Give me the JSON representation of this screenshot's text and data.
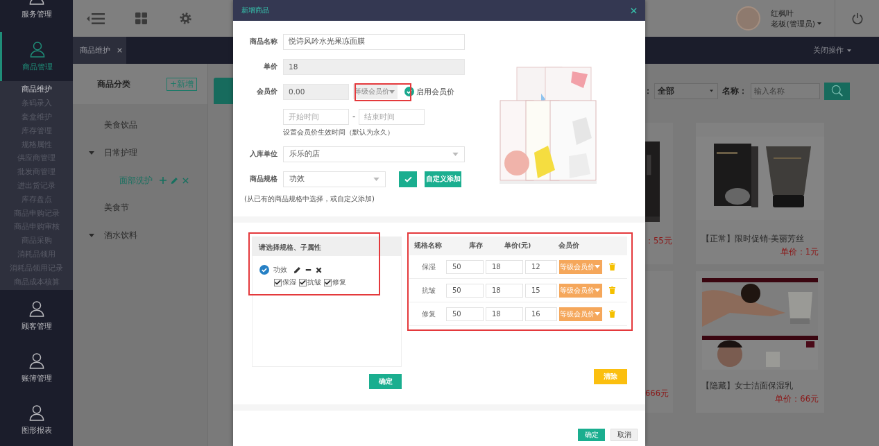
{
  "sidebar": {
    "items": [
      {
        "label": "服务管理",
        "selected": false
      },
      {
        "label": "商品管理",
        "selected": true,
        "children": [
          {
            "label": "商品维护",
            "selected": true
          },
          {
            "label": "条码录入",
            "selected": false
          },
          {
            "label": "套盒维护",
            "selected": false
          },
          {
            "label": "库存管理",
            "selected": false
          },
          {
            "label": "规格属性",
            "selected": false
          },
          {
            "label": "供应商管理",
            "selected": false
          },
          {
            "label": "批发商管理",
            "selected": false
          },
          {
            "label": "进出货记录",
            "selected": false
          },
          {
            "label": "库存盘点",
            "selected": false
          },
          {
            "label": "商品申购记录",
            "selected": false
          },
          {
            "label": "商品申购审核",
            "selected": false
          },
          {
            "label": "商品采购",
            "selected": false
          },
          {
            "label": "消耗品领用",
            "selected": false
          },
          {
            "label": "消耗品领用记录",
            "selected": false
          },
          {
            "label": "商品成本核算",
            "selected": false
          }
        ]
      },
      {
        "label": "顾客管理",
        "selected": false
      },
      {
        "label": "账簿管理",
        "selected": false
      },
      {
        "label": "图形报表",
        "selected": false
      }
    ]
  },
  "header": {
    "user": {
      "name": "红枫叶",
      "role": "老板(管理员)"
    }
  },
  "tabs": [
    {
      "label": "商品维护",
      "selected": true
    }
  ],
  "close_menu": "关闭操作",
  "category_panel": {
    "title": "商品分类",
    "add_button": "+新增",
    "tree": [
      {
        "label": "美食饮品",
        "kind": "leaf",
        "selected": false
      },
      {
        "label": "日常护理",
        "kind": "group",
        "expanded": true,
        "selected": false,
        "children": [
          {
            "label": "面部洗护",
            "selected": true
          }
        ]
      },
      {
        "label": "美食节",
        "kind": "leaf",
        "selected": false
      },
      {
        "label": "酒水饮料",
        "kind": "group",
        "expanded": true,
        "selected": false
      }
    ]
  },
  "filter": {
    "type_label": "：",
    "type_value": "全部",
    "name_label": "名称：",
    "name_placeholder": "输入名称"
  },
  "product_columns": [
    {
      "kind": "partial",
      "cards": [
        {
          "price": "：55元"
        },
        {
          "price": "666元"
        }
      ]
    },
    {
      "kind": "full",
      "cards": [
        {
          "title": "【正常】限时促销-美丽芳丝",
          "price": "单价：1元"
        },
        {
          "title": "【隐藏】女士洁面保湿乳",
          "price": "单价：66元"
        }
      ]
    }
  ],
  "dialog": {
    "title": "新增商品",
    "name": {
      "label": "商品名称",
      "value": "悦诗风吟水光果冻面膜"
    },
    "price": {
      "label": "单价",
      "value": "18",
      "disabled": true
    },
    "member_price": {
      "label": "会员价",
      "value": "0.00",
      "disabled": true,
      "level_select": "等级会员价",
      "enable": {
        "label": "启用会员价",
        "checked": true
      }
    },
    "period": {
      "start_placeholder": "开始时间",
      "separator": "-",
      "end_placeholder": "结束时间",
      "hint": "设置会员价生效时间（默认为永久）"
    },
    "store": {
      "label": "入库单位",
      "value": "乐乐的店"
    },
    "spec": {
      "label": "商品规格",
      "value": "功效",
      "custom_button": "自定义添加",
      "hint": "(从已有的商品规格中选择，或自定义添加)"
    },
    "spec_picker": {
      "title": "请选择规格、子属性",
      "groups": [
        {
          "label": "功效",
          "checked": true,
          "options": [
            {
              "label": "保湿",
              "checked": true
            },
            {
              "label": "抗皱",
              "checked": true
            },
            {
              "label": "修复",
              "checked": true
            }
          ]
        }
      ],
      "confirm_button": "确定"
    },
    "spec_table": {
      "columns": [
        "规格名称",
        "库存",
        "单价(元)",
        "会员价"
      ],
      "rows": [
        {
          "name": "保湿",
          "stock": "50",
          "price": "18",
          "member_price": "12",
          "level_button": "等级会员价"
        },
        {
          "name": "抗皱",
          "stock": "50",
          "price": "18",
          "member_price": "15",
          "level_button": "等级会员价"
        },
        {
          "name": "修复",
          "stock": "50",
          "price": "18",
          "member_price": "16",
          "level_button": "等级会员价"
        }
      ],
      "clear_button": "清除"
    },
    "footer": {
      "ok_button": "确定",
      "cancel_button": "取消"
    }
  }
}
